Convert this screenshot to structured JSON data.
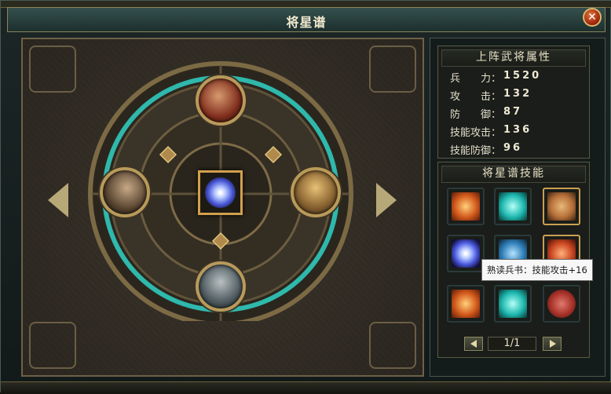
{
  "window": {
    "title": "将星谱"
  },
  "stats_panel": {
    "title": "上阵武将属性",
    "rows": [
      {
        "label": "兵　　力：",
        "value": "1520"
      },
      {
        "label": "攻　　击：",
        "value": "132"
      },
      {
        "label": "防　　御：",
        "value": "87"
      },
      {
        "label": "技能攻击：",
        "value": "136"
      },
      {
        "label": "技能防御：",
        "value": "96"
      }
    ]
  },
  "skills_panel": {
    "title": "将星谱技能",
    "skills": [
      {
        "icon": "flame-sword-icon",
        "color": "#d35a1c"
      },
      {
        "icon": "teal-shield-icon",
        "color": "#1fb9b0"
      },
      {
        "icon": "hero-skill-icon",
        "color": "#b6703a"
      },
      {
        "icon": "blue-orb-icon",
        "color": "#4a5ae0"
      },
      {
        "icon": "armor-icon",
        "color": "#2f7fb8"
      },
      {
        "icon": "red-target-icon",
        "color": "#c8451f"
      },
      {
        "icon": "flame-sword-icon",
        "color": "#d35a1c"
      },
      {
        "icon": "teal-shield-icon",
        "color": "#1fb9b0"
      },
      {
        "icon": "red-scroll-icon",
        "color": "#a8322a"
      }
    ],
    "tooltip": "熟读兵书：技能攻击+16",
    "pager": {
      "label": "1/1"
    }
  },
  "colors": {
    "ring": "#2fb8ac",
    "gold": "#d2a04c"
  }
}
